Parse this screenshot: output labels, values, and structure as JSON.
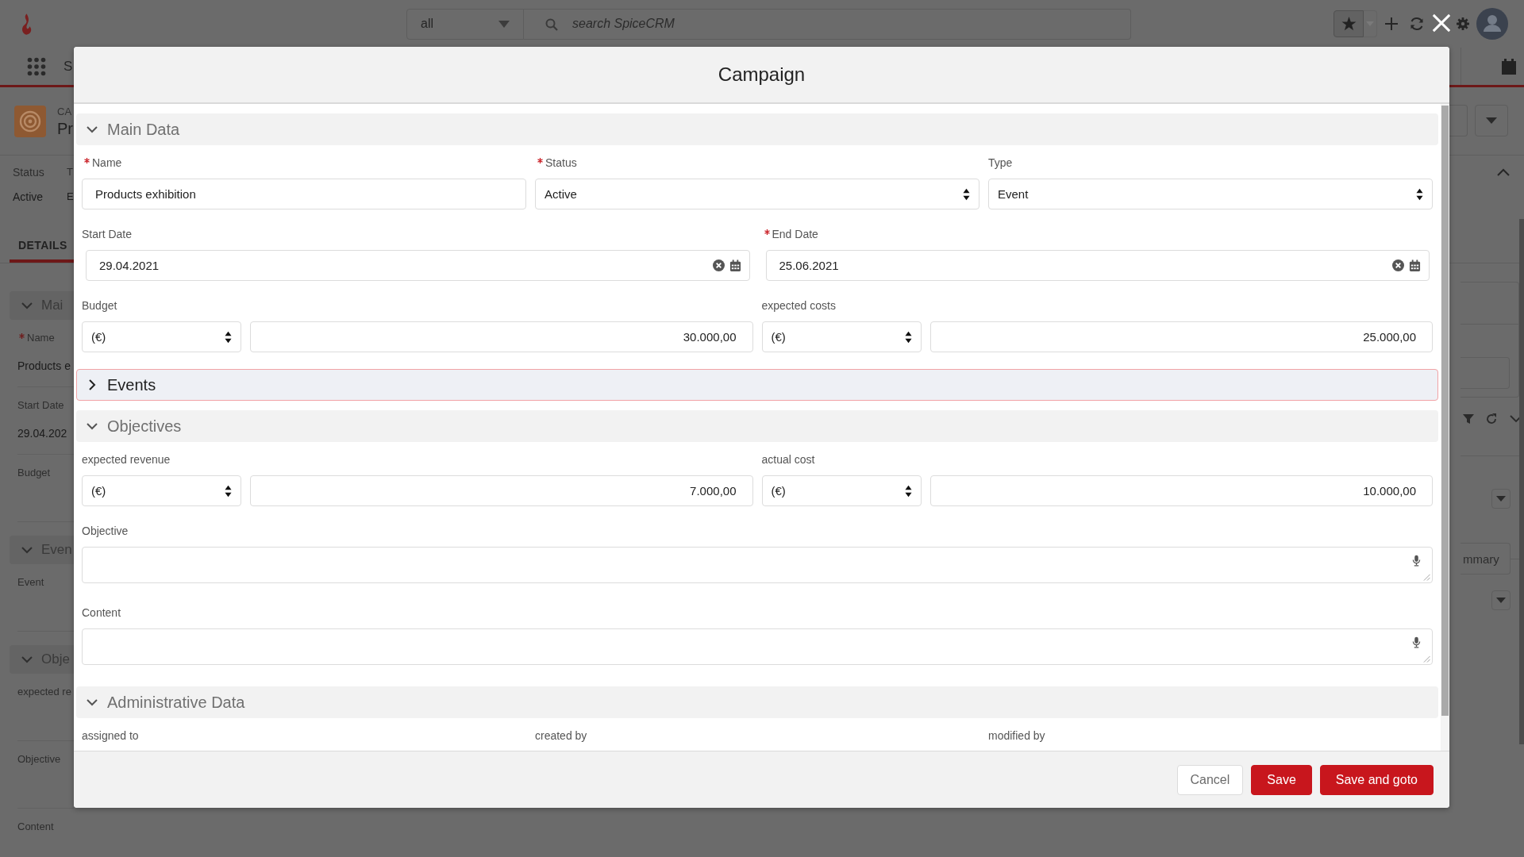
{
  "top_bar": {
    "search_scope": "all",
    "search_placeholder": "search SpiceCRM"
  },
  "nav_bar": {
    "title": "S"
  },
  "record": {
    "module": "CA",
    "name": "Pr",
    "fields": [
      {
        "label": "Status",
        "value": "Active"
      },
      {
        "label": "T",
        "value": "E"
      }
    ]
  },
  "tabs": [
    {
      "label": "DETAILS",
      "selected": true
    }
  ],
  "detail_panel": {
    "sections": [
      {
        "title": "Mai",
        "expanded": true,
        "fields": [
          {
            "label": "Name",
            "required": true,
            "value": "Products e"
          },
          {
            "label": "Start Date",
            "required": false,
            "value": "29.04.202"
          },
          {
            "label": "Budget",
            "required": false
          }
        ]
      },
      {
        "title": "Even",
        "expanded": true,
        "fields": [
          {
            "label": "Event",
            "required": false
          }
        ]
      },
      {
        "title": "Obje",
        "expanded": true,
        "fields": [
          {
            "label": "expected re",
            "required": false
          },
          {
            "label": "Objective",
            "required": false
          },
          {
            "label": "Content",
            "required": false
          }
        ]
      }
    ]
  },
  "side_panel": {
    "button": "mmary"
  },
  "modal": {
    "title": "Campaign",
    "sections": [
      {
        "title": "Main Data",
        "expanded": true,
        "focused": false,
        "rows": [
          [
            {
              "kind": "text",
              "label": "Name",
              "required": true,
              "value": "Products exhibition"
            },
            {
              "kind": "select",
              "label": "Status",
              "required": true,
              "value": "Active"
            },
            {
              "kind": "select",
              "label": "Type",
              "required": false,
              "value": "Event"
            }
          ],
          [
            {
              "kind": "date",
              "label": "Start Date",
              "required": false,
              "value": "29.04.2021"
            },
            {
              "kind": "date",
              "label": "End Date",
              "required": true,
              "value": "25.06.2021"
            }
          ],
          [
            {
              "kind": "currency",
              "label": "Budget",
              "required": false,
              "currency": "(€)",
              "amount": "30.000,00"
            },
            {
              "kind": "currency",
              "label": "expected costs",
              "required": false,
              "currency": "(€)",
              "amount": "25.000,00"
            }
          ]
        ]
      },
      {
        "title": "Events",
        "expanded": false,
        "focused": true
      },
      {
        "title": "Objectives",
        "expanded": true,
        "focused": false,
        "rows": [
          [
            {
              "kind": "currency",
              "label": "expected revenue",
              "required": false,
              "currency": "(€)",
              "amount": "7.000,00"
            },
            {
              "kind": "currency",
              "label": "actual cost",
              "required": false,
              "currency": "(€)",
              "amount": "10.000,00"
            }
          ],
          [
            {
              "kind": "textarea",
              "label": "Objective",
              "required": false
            }
          ],
          [
            {
              "kind": "textarea",
              "label": "Content",
              "required": false
            }
          ]
        ]
      },
      {
        "title": "Administrative Data",
        "expanded": true,
        "focused": false,
        "rows": [
          [
            {
              "kind": "readonly",
              "label": "assigned to",
              "required": false
            },
            {
              "kind": "readonly",
              "label": "created by",
              "required": false
            },
            {
              "kind": "readonly",
              "label": "modified by",
              "required": false
            }
          ]
        ]
      }
    ],
    "buttons": [
      {
        "label": "Cancel",
        "kind": "secondary"
      },
      {
        "label": "Save",
        "kind": "primary"
      },
      {
        "label": "Save and goto",
        "kind": "primary"
      }
    ]
  }
}
